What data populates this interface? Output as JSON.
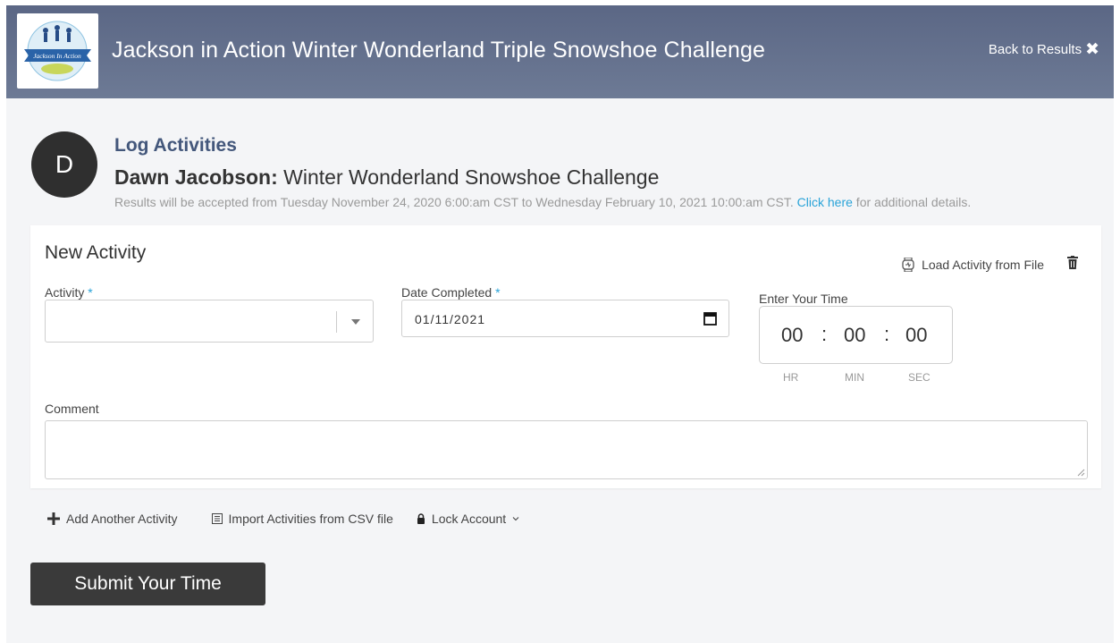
{
  "header": {
    "logo_text": "Jackson In Action",
    "title": "Jackson in Action Winter Wonderland Triple Snowshoe Challenge",
    "back_label": "Back to Results",
    "back_icon": "close-icon"
  },
  "participant": {
    "avatar_initial": "D",
    "section_title": "Log Activities",
    "name": "Dawn Jacobson:",
    "event": " Winter Wonderland Snowshoe Challenge",
    "accept_text": "Results will be accepted from Tuesday November 24, 2020 6:00:am CST to Wednesday February 10, 2021 10:00:am CST.",
    "accept_link": "Click here",
    "accept_suffix": " for additional details."
  },
  "form": {
    "card_title": "New Activity",
    "load_file_label": "Load Activity from File",
    "activity_label": "Activity",
    "activity_value": "",
    "date_label": "Date Completed",
    "required_mark": "*",
    "date_value": "01/11/2021",
    "time_label": "Enter Your Time",
    "time": {
      "hr": "00",
      "min": "00",
      "sec": "00",
      "separator": ":"
    },
    "time_units": {
      "hr": "HR",
      "min": "MIN",
      "sec": "SEC"
    },
    "comment_label": "Comment",
    "comment_value": ""
  },
  "actions": {
    "add_another": "Add Another Activity",
    "import_csv": "Import Activities from CSV file",
    "lock_account": "Lock Account"
  },
  "submit_label": "Submit Your Time",
  "colors": {
    "header_bg": "#5b6785",
    "accent_title": "#43577b",
    "link": "#29a3d8",
    "submit_bg": "#3a3a3a",
    "page_bg": "#f4f5f7"
  }
}
